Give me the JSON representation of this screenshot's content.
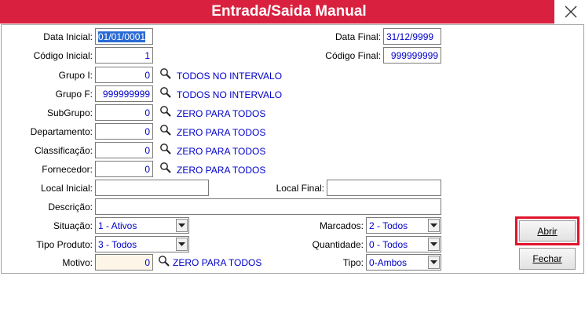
{
  "window": {
    "title": "Entrada/Saida Manual",
    "close_glyph": "✕"
  },
  "form": {
    "data_inicial": {
      "label": "Data Inicial:",
      "value": "01/01/0001"
    },
    "data_final": {
      "label": "Data Final:",
      "value": "31/12/9999"
    },
    "codigo_inicial": {
      "label": "Código Inicial:",
      "value": "1"
    },
    "codigo_final": {
      "label": "Código Final:",
      "value": "999999999"
    },
    "grupo_i": {
      "label": "Grupo I:",
      "value": "0",
      "info": "TODOS NO INTERVALO"
    },
    "grupo_f": {
      "label": "Grupo F:",
      "value": "999999999",
      "info": "TODOS NO INTERVALO"
    },
    "subgrupo": {
      "label": "SubGrupo:",
      "value": "0",
      "info": "ZERO PARA TODOS"
    },
    "departamento": {
      "label": "Departamento:",
      "value": "0",
      "info": "ZERO PARA TODOS"
    },
    "classificacao": {
      "label": "Classificação:",
      "value": "0",
      "info": "ZERO PARA TODOS"
    },
    "fornecedor": {
      "label": "Fornecedor:",
      "value": "0",
      "info": "ZERO PARA TODOS"
    },
    "local_inicial": {
      "label": "Local Inicial:",
      "value": ""
    },
    "local_final": {
      "label": "Local Final:",
      "value": ""
    },
    "descricao": {
      "label": "Descrição:",
      "value": ""
    },
    "situacao": {
      "label": "Situação:",
      "value": "1 - Ativos"
    },
    "marcados": {
      "label": "Marcados:",
      "value": "2 - Todos"
    },
    "tipo_produto": {
      "label": "Tipo Produto:",
      "value": "3 - Todos"
    },
    "quantidade": {
      "label": "Quantidade:",
      "value": "0 - Todos"
    },
    "motivo": {
      "label": "Motivo:",
      "value": "0",
      "info": "ZERO PARA TODOS"
    },
    "tipo": {
      "label": "Tipo:",
      "value": "0-Ambos"
    }
  },
  "buttons": {
    "abrir": "Abrir",
    "fechar": "Fechar"
  },
  "icons": {
    "search": "search-icon",
    "dropdown": "chevron-down-icon",
    "close": "close-icon"
  },
  "colors": {
    "titlebar": "#d9213f",
    "value_text": "#0000c8",
    "highlight": "#e0142d",
    "selection": "#2a6ad3",
    "motivo_bg": "#fdf6e8"
  }
}
